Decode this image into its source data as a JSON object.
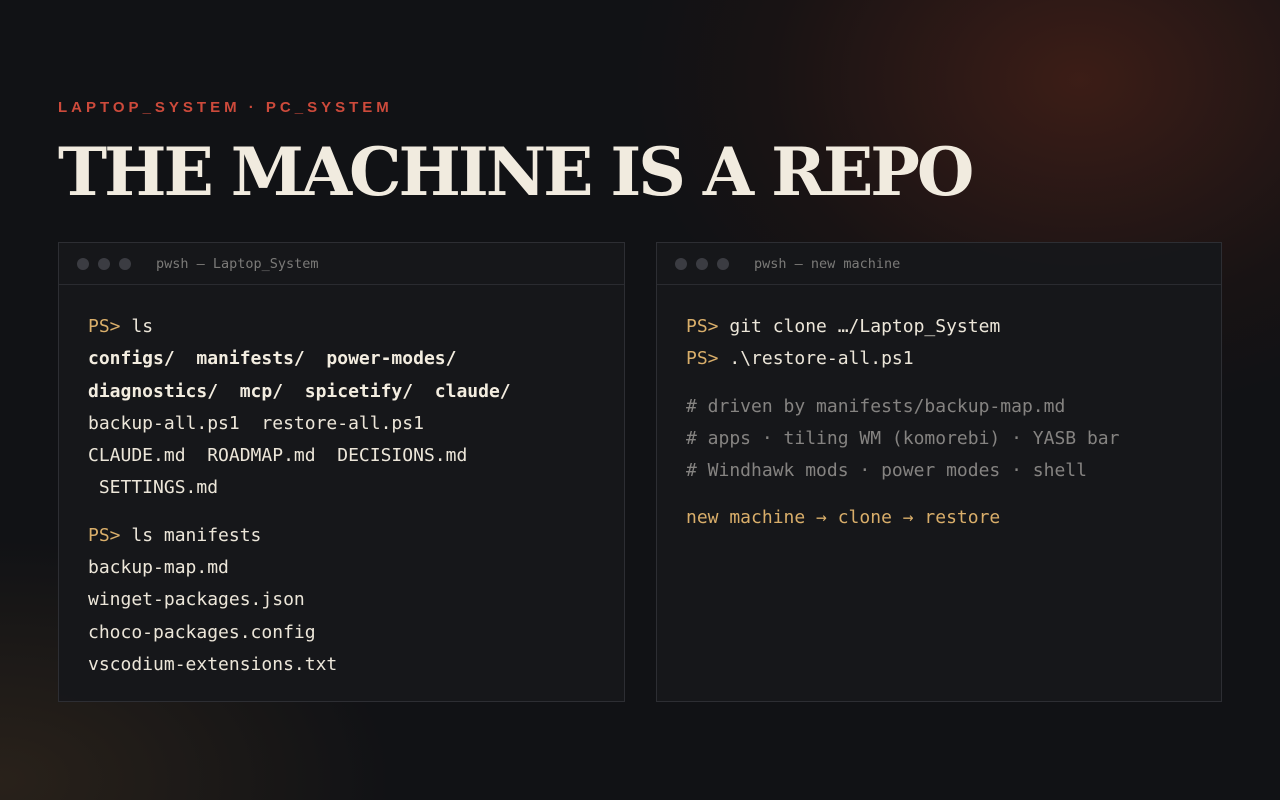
{
  "header": {
    "eyebrow": "LAPTOP_SYSTEM · PC_SYSTEM",
    "title": "THE MACHINE IS A REPO"
  },
  "colors": {
    "accent_red": "#cd4a3b",
    "prompt_gold": "#d9ae6a",
    "title_cream": "#f1ebdf",
    "comment_gray": "#858381",
    "background": "#111215"
  },
  "terminals": [
    {
      "title": "pwsh — Laptop_System",
      "blocks": [
        {
          "prompt": "PS>",
          "command": " ls",
          "output": [
            {
              "text": "configs/  manifests/  power-modes/",
              "style": "bold"
            },
            {
              "text": "diagnostics/  mcp/  spicetify/  claude/",
              "style": "bold"
            },
            {
              "text": "backup-all.ps1  restore-all.ps1",
              "style": "normal"
            },
            {
              "text": "CLAUDE.md  ROADMAP.md  DECISIONS.md",
              "style": "normal"
            },
            {
              "text": " SETTINGS.md",
              "style": "normal"
            }
          ]
        },
        {
          "prompt": "PS>",
          "command": " ls manifests",
          "output": [
            {
              "text": "backup-map.md",
              "style": "normal"
            },
            {
              "text": "winget-packages.json",
              "style": "normal"
            },
            {
              "text": "choco-packages.config",
              "style": "normal"
            },
            {
              "text": "vscodium-extensions.txt",
              "style": "normal"
            }
          ]
        }
      ]
    },
    {
      "title": "pwsh — new machine",
      "commands": [
        {
          "prompt": "PS>",
          "command": " git clone …/Laptop_System"
        },
        {
          "prompt": "PS>",
          "command": " .\\restore-all.ps1"
        }
      ],
      "comments": [
        "# driven by manifests/backup-map.md",
        "# apps · tiling WM (komorebi) · YASB bar",
        "# Windhawk mods · power modes · shell"
      ],
      "flow": "new machine → clone → restore"
    }
  ]
}
